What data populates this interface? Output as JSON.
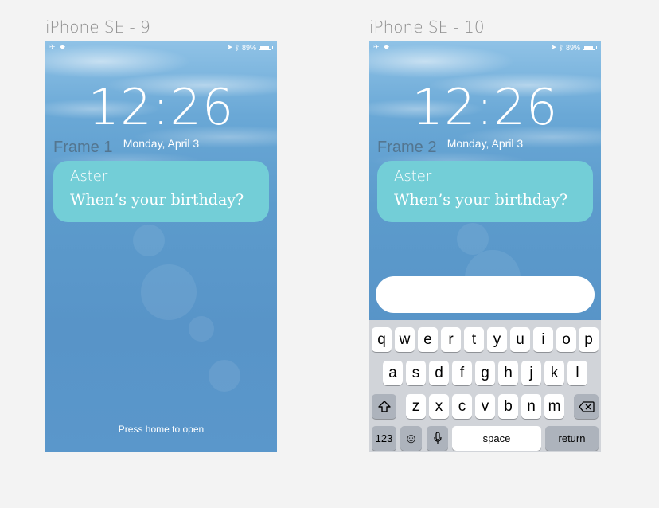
{
  "frames": [
    {
      "title": "iPhone SE - 9",
      "frame_label": "Frame 1",
      "status": {
        "battery_text": "89%"
      },
      "clock": "12:26",
      "date": "Monday, April 3",
      "notification": {
        "sender": "Aster",
        "message": "When’s your birthday?"
      },
      "footer": "Press home to open"
    },
    {
      "title": "iPhone SE - 10",
      "frame_label": "Frame 2",
      "status": {
        "battery_text": "89%"
      },
      "clock": "12:26",
      "date": "Monday, April 3",
      "notification": {
        "sender": "Aster",
        "message": "When’s your birthday?"
      },
      "reply": {
        "value": "",
        "placeholder": ""
      },
      "keyboard": {
        "row1": [
          "q",
          "w",
          "e",
          "r",
          "t",
          "y",
          "u",
          "i",
          "o",
          "p"
        ],
        "row2": [
          "a",
          "s",
          "d",
          "f",
          "g",
          "h",
          "j",
          "k",
          "l"
        ],
        "row3": [
          "z",
          "x",
          "c",
          "v",
          "b",
          "n",
          "m"
        ],
        "numbers_label": "123",
        "space_label": "space",
        "return_label": "return"
      }
    }
  ],
  "icons": [
    "airplane-icon",
    "wifi-icon",
    "location-icon",
    "bluetooth-icon",
    "battery-icon",
    "shift-icon",
    "backspace-icon",
    "emoji-icon",
    "microphone-icon"
  ]
}
